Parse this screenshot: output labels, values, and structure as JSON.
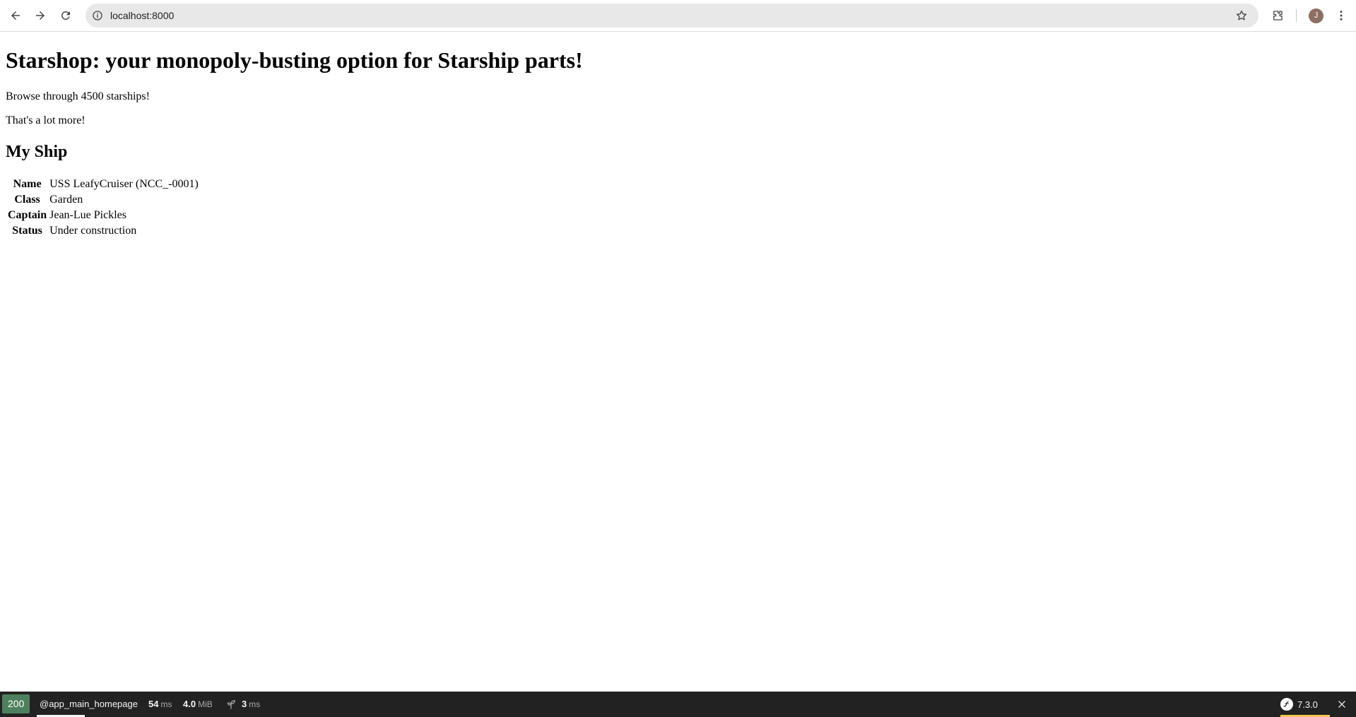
{
  "browser": {
    "url": "localhost:8000",
    "profile_initial": "J",
    "icons": {
      "back": "arrow-left-icon",
      "forward": "arrow-right-icon",
      "reload": "reload-icon",
      "site_info": "info-icon",
      "bookmark": "star-icon",
      "extensions": "puzzle-icon",
      "menu": "kebab-menu-icon"
    }
  },
  "page": {
    "title": "Starshop: your monopoly-busting option for Starship parts!",
    "intro": "Browse through 4500 starships!",
    "note": "That's a lot more!",
    "section_title": "My Ship",
    "ship": [
      {
        "label": "Name",
        "value": "USS LeafyCruiser (NCC_-0001)"
      },
      {
        "label": "Class",
        "value": "Garden"
      },
      {
        "label": "Captain",
        "value": "Jean-Lue Pickles"
      },
      {
        "label": "Status",
        "value": "Under construction"
      }
    ]
  },
  "debug_toolbar": {
    "status_code": "200",
    "route": "@app_main_homepage",
    "time_value": "54",
    "time_unit": "ms",
    "memory_value": "4.0",
    "memory_unit": "MiB",
    "twig_value": "3",
    "twig_unit": "ms",
    "version": "7.3.0",
    "colors": {
      "background": "#222222",
      "status_ok": "#4f805d",
      "version_accent": "#f2c94c"
    }
  }
}
